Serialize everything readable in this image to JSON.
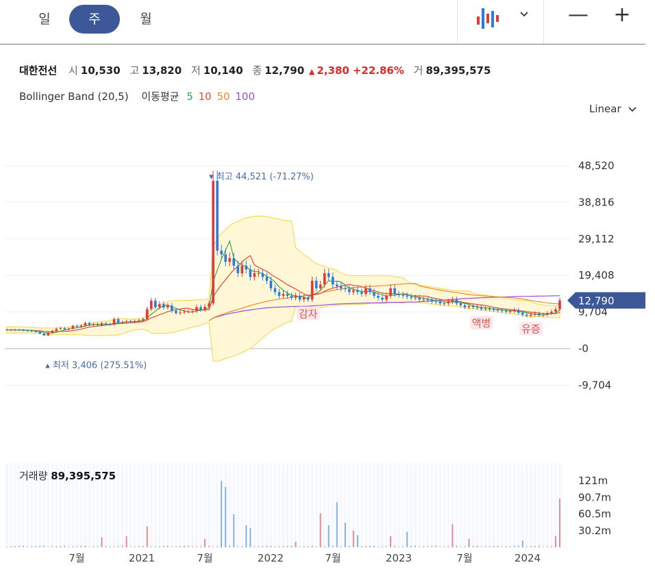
{
  "periods": [
    {
      "label": "일",
      "active": false
    },
    {
      "label": "주",
      "active": true
    },
    {
      "label": "월",
      "active": false
    }
  ],
  "toolbar": {
    "chart_type_icon": "candlestick-icon",
    "dropdown_icon": "chevron-down-icon",
    "zoom_out": "—",
    "zoom_in": "+"
  },
  "quote": {
    "name": "대한전선",
    "open_label": "시",
    "open": "10,530",
    "high_label": "고",
    "high": "13,820",
    "low_label": "저",
    "low": "10,140",
    "close_label": "종",
    "close": "12,790",
    "change_arrow": "▲",
    "change": "2,380",
    "change_pct": "+22.86%",
    "volume_label": "거",
    "volume": "89,395,575"
  },
  "indicators": {
    "bollinger": "Bollinger Band (20,5)",
    "ma_label": "이동평균",
    "ma": [
      {
        "period": "5",
        "color": "#3aa84a"
      },
      {
        "period": "10",
        "color": "#e8463c"
      },
      {
        "period": "50",
        "color": "#ee8a2a"
      },
      {
        "period": "100",
        "color": "#9a4ee0"
      }
    ]
  },
  "scale_mode": "Linear",
  "chart_data": {
    "type": "candlestick",
    "y_ticks": [
      "48,520",
      "38,816",
      "29,112",
      "19,408",
      "9,704",
      "-0",
      "-9,704"
    ],
    "y_tick_values": [
      48520,
      38816,
      29112,
      19408,
      9704,
      0,
      -9704
    ],
    "current_price_label": "12,790",
    "current_price": 12790,
    "high_marker": {
      "label": "최고",
      "value_text": "44,521 (-71.27%)",
      "value": 44521
    },
    "low_marker": {
      "label": "최저",
      "value_text": "3,406 (275.51%)",
      "value": 3406
    },
    "events": [
      "감자",
      "액병",
      "유증"
    ],
    "x_labels": [
      "7월",
      "2021",
      "7월",
      "2022",
      "7월",
      "2023",
      "7월",
      "2024"
    ],
    "price_close_weekly": [
      5000,
      4900,
      5000,
      4900,
      4800,
      4700,
      4600,
      4400,
      4000,
      3500,
      4200,
      4700,
      5200,
      5400,
      5100,
      5300,
      6000,
      5800,
      6100,
      6800,
      6300,
      6500,
      6200,
      6700,
      6500,
      6400,
      7800,
      6900,
      7000,
      7200,
      7100,
      7300,
      7500,
      7800,
      10500,
      12700,
      11000,
      11800,
      10900,
      11400,
      10000,
      9400,
      9600,
      9800,
      9800,
      9900,
      11000,
      10300,
      11100,
      12000,
      44521,
      26000,
      25000,
      23000,
      24000,
      22000,
      20000,
      22000,
      21000,
      19000,
      20000,
      20000,
      19000,
      18000,
      16000,
      15000,
      14000,
      14500,
      14000,
      13500,
      14000,
      13000,
      13500,
      13000,
      18000,
      16000,
      17000,
      20000,
      19000,
      17000,
      16500,
      16000,
      15800,
      15000,
      15500,
      15000,
      14500,
      16000,
      15000,
      14000,
      13500,
      13000,
      14000,
      16000,
      14500,
      14200,
      14000,
      13800,
      13500,
      13500,
      13000,
      13000,
      12900,
      12500,
      12400,
      12000,
      12000,
      12500,
      13000,
      12000,
      11500,
      11000,
      11300,
      11000,
      10800,
      10500,
      10600,
      10400,
      10300,
      10100,
      10000,
      9800,
      9900,
      10200,
      9500,
      9000,
      8700,
      9000,
      9300,
      8800,
      9000,
      9400,
      9800,
      10410,
      12790
    ],
    "ma100_color": "#9a4ee0",
    "bollinger_color": "#f5dc5c",
    "volume": {
      "label": "거래량",
      "value": "89,395,575",
      "y_ticks": [
        "121m",
        "90.7m",
        "60.5m",
        "30.2m"
      ],
      "y_tick_values": [
        121,
        90.7,
        60.5,
        30.2
      ],
      "unit": "m",
      "spikes": [
        {
          "week": 23,
          "value": 18
        },
        {
          "week": 29,
          "value": 20
        },
        {
          "week": 34,
          "value": 38
        },
        {
          "week": 48,
          "value": 15
        },
        {
          "week": 52,
          "value": 121
        },
        {
          "week": 53,
          "value": 110
        },
        {
          "week": 55,
          "value": 60
        },
        {
          "week": 58,
          "value": 40
        },
        {
          "week": 59,
          "value": 35
        },
        {
          "week": 70,
          "value": 10
        },
        {
          "week": 76,
          "value": 62
        },
        {
          "week": 78,
          "value": 40
        },
        {
          "week": 80,
          "value": 82
        },
        {
          "week": 82,
          "value": 45
        },
        {
          "week": 84,
          "value": 30
        },
        {
          "week": 85,
          "value": 22
        },
        {
          "week": 93,
          "value": 20
        },
        {
          "week": 97,
          "value": 28
        },
        {
          "week": 108,
          "value": 42
        },
        {
          "week": 112,
          "value": 15
        },
        {
          "week": 125,
          "value": 12
        },
        {
          "week": 133,
          "value": 20
        },
        {
          "week": 134,
          "value": 89
        }
      ]
    }
  }
}
